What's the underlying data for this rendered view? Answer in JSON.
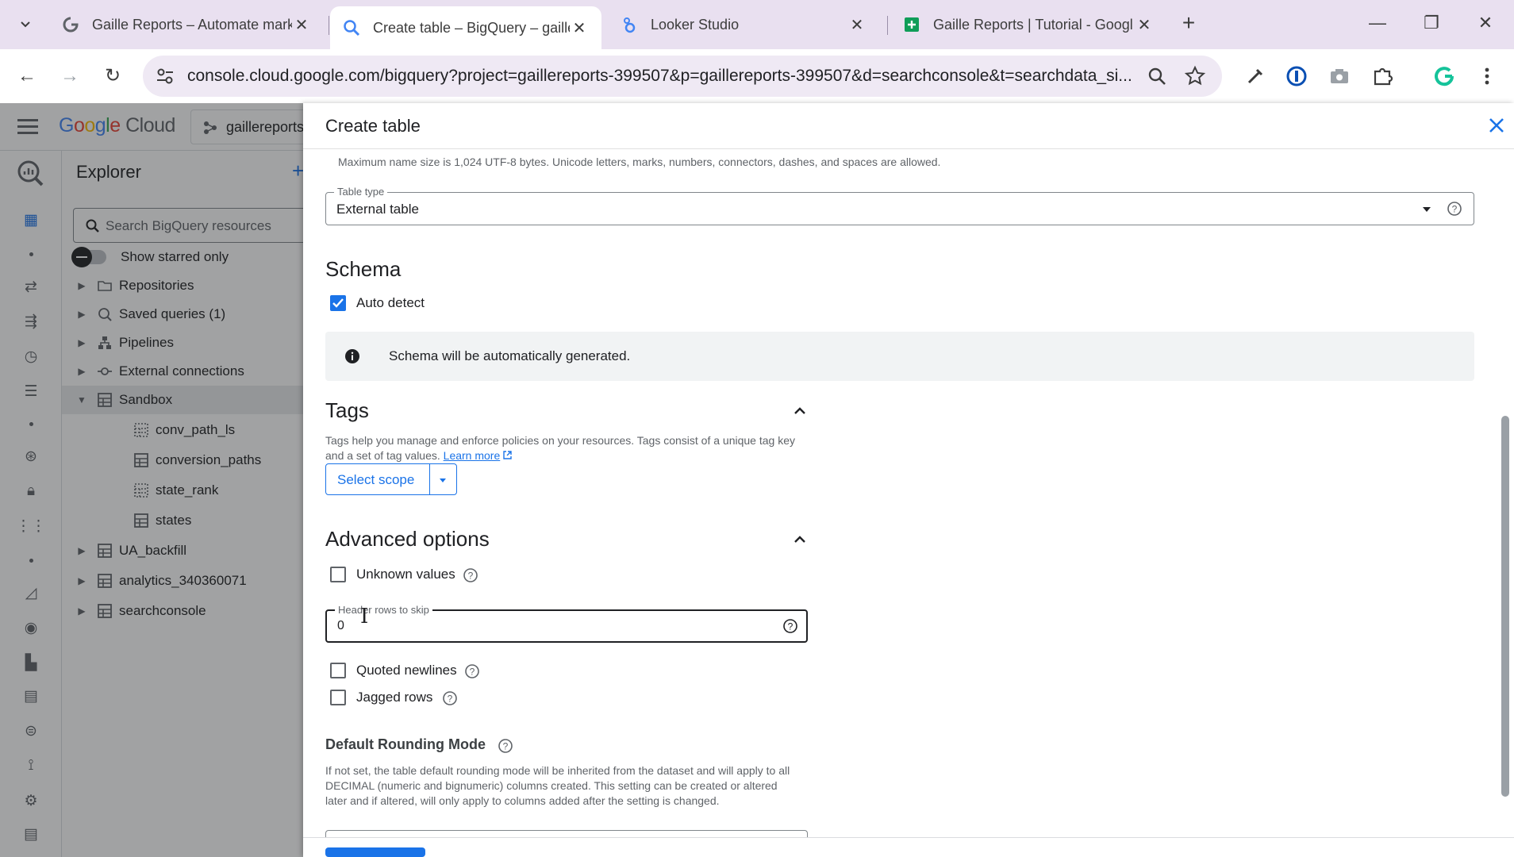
{
  "browser": {
    "tabs": [
      {
        "title": "Gaille Reports – Automate mark",
        "active": false
      },
      {
        "title": "Create table – BigQuery – gaille",
        "active": true
      },
      {
        "title": "Looker Studio",
        "active": false
      },
      {
        "title": "Gaille Reports | Tutorial - Googl",
        "active": false
      }
    ],
    "url": "console.cloud.google.com/bigquery?project=gaillereports-399507&p=gaillereports-399507&d=searchconsole&t=searchdata_si...",
    "new_tab": "+",
    "minimize": "—",
    "restore": "❐",
    "close": "✕",
    "back": "←",
    "forward": "→",
    "reload": "↻"
  },
  "console": {
    "logo_google": [
      "G",
      "o",
      "o",
      "g",
      "l",
      "e"
    ],
    "logo_cloud": "Cloud",
    "project": "gaillereports"
  },
  "explorer": {
    "title": "Explorer",
    "add": "+",
    "search_placeholder": "Search BigQuery resources",
    "starred_label": "Show starred only",
    "tree": [
      {
        "label": "Repositories",
        "icon": "repo-icon",
        "expanded": false,
        "level": 0
      },
      {
        "label": "Saved queries (1)",
        "icon": "saved-query-icon",
        "expanded": false,
        "level": 0
      },
      {
        "label": "Pipelines",
        "icon": "pipeline-icon",
        "expanded": false,
        "level": 0
      },
      {
        "label": "External connections",
        "icon": "connection-icon",
        "expanded": false,
        "level": 0
      },
      {
        "label": "Sandbox",
        "icon": "dataset-icon",
        "expanded": true,
        "level": 0,
        "selected": true
      },
      {
        "label": "conv_path_ls",
        "icon": "external-table-icon",
        "level": 1
      },
      {
        "label": "conversion_paths",
        "icon": "table-icon",
        "level": 1
      },
      {
        "label": "state_rank",
        "icon": "external-table-icon",
        "level": 1
      },
      {
        "label": "states",
        "icon": "table-icon",
        "level": 1
      },
      {
        "label": "UA_backfill",
        "icon": "dataset-icon",
        "expanded": false,
        "level": 0
      },
      {
        "label": "analytics_340360071",
        "icon": "dataset-icon",
        "expanded": false,
        "level": 0
      },
      {
        "label": "searchconsole",
        "icon": "dataset-icon",
        "expanded": false,
        "level": 0
      }
    ]
  },
  "panel": {
    "title": "Create table",
    "name_hint": "Maximum name size is 1,024 UTF-8 bytes. Unicode letters, marks, numbers, connectors, dashes, and spaces are allowed.",
    "table_type": {
      "label": "Table type",
      "value": "External table"
    },
    "schema": {
      "title": "Schema",
      "auto_detect_label": "Auto detect",
      "auto_detect_checked": true,
      "info": "Schema will be automatically generated."
    },
    "tags": {
      "title": "Tags",
      "description_line1": "Tags help you manage and enforce policies on your resources. Tags consist of a unique tag key",
      "description_line2": "and a set of tag values.",
      "learn_more": "Learn more",
      "select_scope": "Select scope"
    },
    "advanced": {
      "title": "Advanced options",
      "unknown_values": "Unknown values",
      "header_rows_label": "Header rows to skip",
      "header_rows_value": "0",
      "quoted_newlines": "Quoted newlines",
      "jagged_rows": "Jagged rows"
    },
    "rounding": {
      "title": "Default Rounding Mode",
      "line1": "If not set, the table default rounding mode will be inherited from the dataset and will apply to all",
      "line2": "DECIMAL (numeric and bignumeric) columns created. This setting can be created or altered",
      "line3": "later and if altered, will only apply to columns added after the setting is changed."
    }
  },
  "colors": {
    "accent": "#1a73e8",
    "tabstrip": "#e9e0f0",
    "selected_row": "#e8eaed",
    "banner": "#f1f3f4"
  }
}
